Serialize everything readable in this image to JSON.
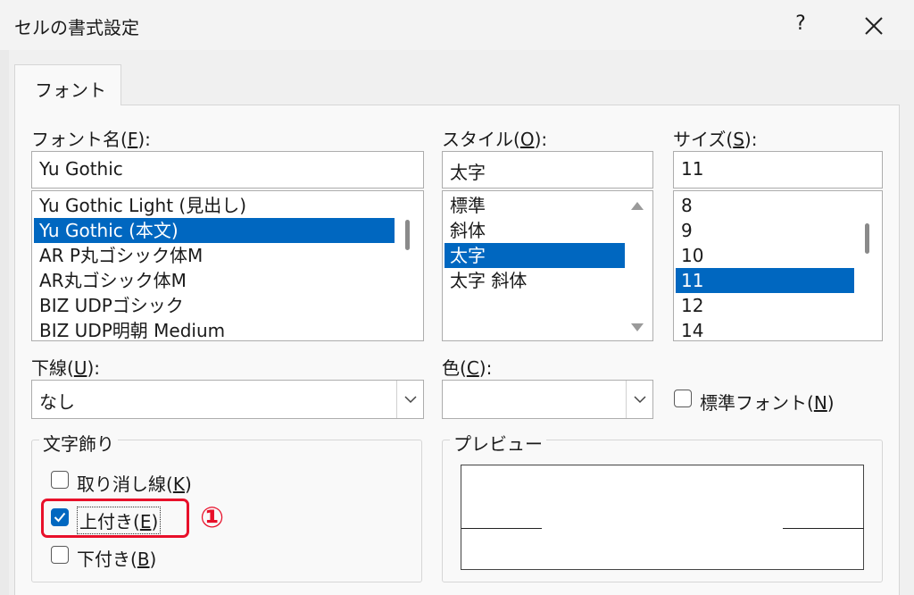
{
  "window": {
    "title": "セルの書式設定",
    "help": "?"
  },
  "tabs": [
    {
      "label": "フォント"
    }
  ],
  "font_name": {
    "label_pre": "フォント名(",
    "key": "F",
    "label_post": "):",
    "value": "Yu Gothic",
    "items": [
      "Yu Gothic Light (見出し)",
      "Yu Gothic (本文)",
      "AR P丸ゴシック体M",
      "AR丸ゴシック体M",
      "BIZ UDPゴシック",
      "BIZ UDP明朝 Medium"
    ],
    "selected": "Yu Gothic (本文)"
  },
  "style": {
    "label_pre": "スタイル(",
    "key": "O",
    "label_post": "):",
    "value": "太字",
    "items": [
      "標準",
      "斜体",
      "太字",
      "太字 斜体"
    ],
    "selected": "太字"
  },
  "size": {
    "label_pre": "サイズ(",
    "key": "S",
    "label_post": "):",
    "value": "11",
    "items": [
      "8",
      "9",
      "10",
      "11",
      "12",
      "14"
    ],
    "selected": "11"
  },
  "underline": {
    "label_pre": "下線(",
    "key": "U",
    "label_post": "):",
    "value": "なし"
  },
  "color": {
    "label_pre": "色(",
    "key": "C",
    "label_post": "):",
    "value": ""
  },
  "normal_font": {
    "label_pre": "標準フォント(",
    "key": "N",
    "label_post": ")",
    "checked": false
  },
  "effects": {
    "title": "文字飾り",
    "strikethrough": {
      "label_pre": "取り消し線(",
      "key": "K",
      "label_post": ")",
      "checked": false
    },
    "superscript": {
      "label_pre": "上付き(",
      "key": "E",
      "label_post": ")",
      "checked": true
    },
    "subscript": {
      "label_pre": "下付き(",
      "key": "B",
      "label_post": ")",
      "checked": false
    }
  },
  "preview": {
    "title": "プレビュー"
  },
  "annotation": {
    "marker": "①",
    "color": "#e8102a"
  },
  "colors": {
    "selection": "#0067c0",
    "background": "#f0f0f0"
  }
}
